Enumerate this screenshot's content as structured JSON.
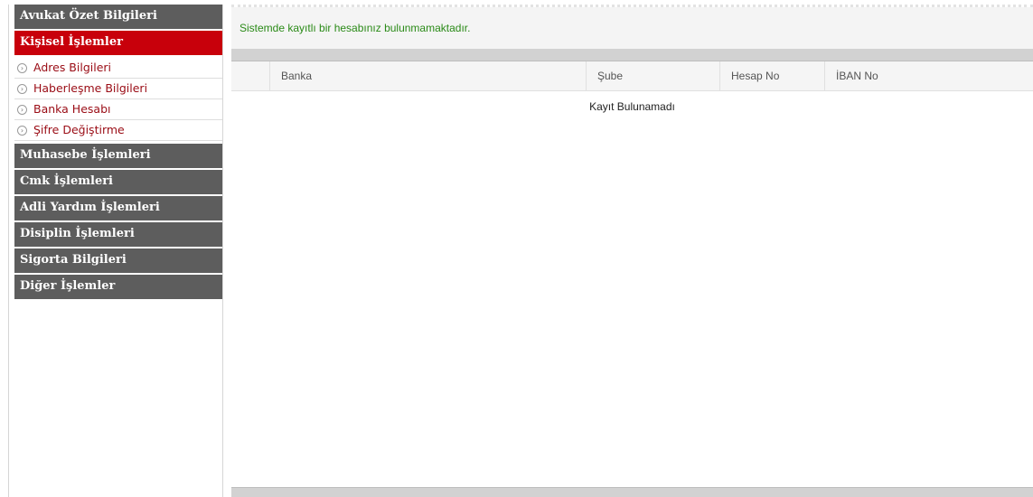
{
  "sidebar": {
    "sections_top": [
      {
        "label": "Avukat Özet Bilgileri",
        "active": false
      },
      {
        "label": "Kişisel İşlemler",
        "active": true
      }
    ],
    "submenu": [
      {
        "label": "Adres Bilgileri",
        "icon": "arrow-circle-icon"
      },
      {
        "label": "Haberleşme Bilgileri",
        "icon": "arrow-circle-icon"
      },
      {
        "label": "Banka Hesabı",
        "icon": "arrow-circle-icon"
      },
      {
        "label": "Şifre Değiştirme",
        "icon": "arrow-circle-icon"
      }
    ],
    "sections_bottom": [
      {
        "label": "Muhasebe İşlemleri"
      },
      {
        "label": "Cmk İşlemleri"
      },
      {
        "label": "Adli Yardım İşlemleri"
      },
      {
        "label": "Disiplin İşlemleri"
      },
      {
        "label": "Sigorta Bilgileri"
      },
      {
        "label": "Diğer İşlemler"
      }
    ]
  },
  "main": {
    "message": "Sistemde kayıtlı bir hesabınız bulunmamaktadır.",
    "table": {
      "columns": [
        "",
        "Banka",
        "Şube",
        "Hesap No",
        "İBAN No"
      ],
      "empty_text": "Kayıt Bulunamadı"
    }
  },
  "colors": {
    "active_menu": "#c8000b",
    "menu": "#5d5d5d",
    "message_text": "#2a8a17",
    "submenu_text": "#9a0c15"
  }
}
